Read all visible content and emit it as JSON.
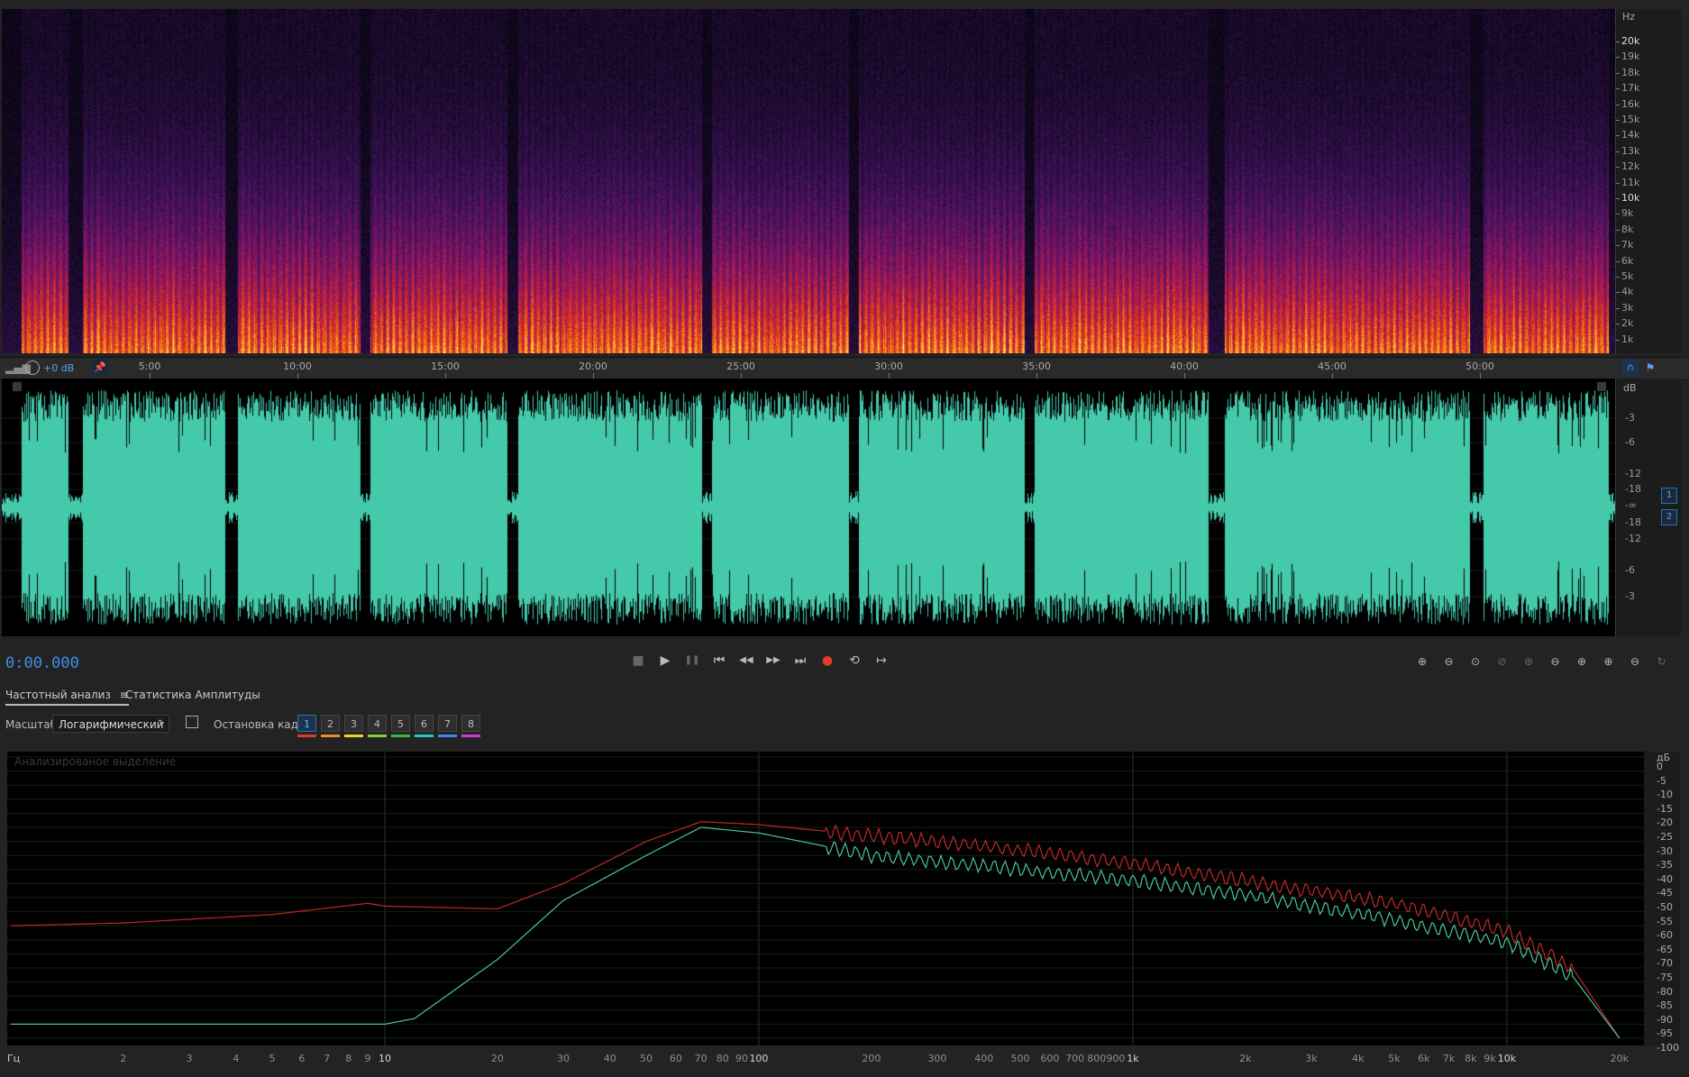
{
  "spectral": {
    "axis_unit": "Hz",
    "freq_ticks": [
      "20k",
      "19k",
      "18k",
      "17k",
      "16k",
      "15k",
      "14k",
      "13k",
      "12k",
      "11k",
      "10k",
      "9k",
      "8k",
      "7k",
      "6k",
      "5k",
      "4k",
      "3k",
      "2k",
      "1k"
    ]
  },
  "ruler": {
    "gain_label": "+0 dB",
    "time_ticks": [
      "5:00",
      "10:00",
      "15:00",
      "20:00",
      "25:00",
      "30:00",
      "35:00",
      "40:00",
      "45:00",
      "50:00"
    ]
  },
  "waveform": {
    "axis_unit": "dB",
    "db_ticks_top": [
      "-3",
      "-6",
      "-12",
      "-18",
      "-∞",
      "-18",
      "-12",
      "-6",
      "-3"
    ],
    "channels": [
      "1",
      "2"
    ],
    "color": "#45c9ab"
  },
  "transport": {
    "timecode": "0:00.000",
    "buttons": {
      "stop": "■",
      "play": "▶",
      "pause": "❚❚",
      "to_start": "⏮",
      "rewind": "◀◀",
      "forward": "▶▶",
      "to_end": "⏭",
      "record": "●",
      "loop": "⟲",
      "skip": "↦"
    }
  },
  "zoom_icons": [
    "zoom-in-amplitude",
    "zoom-out-amplitude",
    "zoom-selection",
    "zoom-out-full",
    "zoom-in-time",
    "zoom-out-time",
    "zoom-in-left",
    "zoom-in-right",
    "zoom-fit",
    "zoom-reset"
  ],
  "panel": {
    "tab_frequency": "Частотный анализ",
    "tab_menu_icon": "≡",
    "tab_amplitude": "Статистика Амплитуды",
    "scale_label": "Масштаб:",
    "scale_value": "Логарифмический",
    "freeze_label": "Остановка кадра:",
    "frames": [
      "1",
      "2",
      "3",
      "4",
      "5",
      "6",
      "7",
      "8"
    ],
    "frame_colors": [
      "#e23a2a",
      "#ee8a2a",
      "#e8d62a",
      "#7ed23a",
      "#3ab84a",
      "#2ac6d2",
      "#3a8ae8",
      "#d23ad2"
    ]
  },
  "frequency_analysis": {
    "selection_label": "Анализированое выделение",
    "db_unit": "дБ",
    "db_ticks": [
      "0",
      "-5",
      "-10",
      "-15",
      "-20",
      "-25",
      "-30",
      "-35",
      "-40",
      "-45",
      "-50",
      "-55",
      "-60",
      "-65",
      "-70",
      "-75",
      "-80",
      "-85",
      "-90",
      "-95",
      "-100"
    ],
    "hz_unit": "Гц",
    "hz_ticks": [
      "2",
      "3",
      "4",
      "5",
      "6",
      "7",
      "8",
      "9",
      "10",
      "20",
      "30",
      "40",
      "50",
      "60",
      "70",
      "80",
      "90",
      "100",
      "200",
      "300",
      "400",
      "500",
      "600",
      "700",
      "800",
      "900",
      "1k",
      "2k",
      "3k",
      "4k",
      "5k",
      "6k",
      "7k",
      "8k",
      "9k",
      "10k",
      "20k"
    ]
  },
  "chart_data": {
    "type": "line",
    "xlabel": "Гц",
    "ylabel": "дБ",
    "x_scale": "log",
    "ylim": [
      -100,
      0
    ],
    "series": [
      {
        "color": "#c0282a",
        "x": [
          1,
          2,
          5,
          9,
          10,
          20,
          30,
          50,
          70,
          100,
          200,
          500,
          1000,
          2000,
          5000,
          10000,
          15000,
          20000
        ],
        "y": [
          -60,
          -59,
          -56,
          -52,
          -53,
          -54,
          -45,
          -30,
          -23,
          -24,
          -28,
          -33,
          -38,
          -44,
          -52,
          -62,
          -75,
          -100
        ]
      },
      {
        "color": "#4cc49a",
        "x": [
          1,
          2,
          5,
          9,
          10,
          12,
          20,
          30,
          50,
          70,
          100,
          200,
          500,
          1000,
          2000,
          5000,
          10000,
          15000,
          20000
        ],
        "y": [
          -95,
          -95,
          -95,
          -95,
          -95,
          -93,
          -72,
          -51,
          -35,
          -25,
          -27,
          -35,
          -40,
          -44,
          -49,
          -58,
          -66,
          -78,
          -100
        ]
      }
    ]
  }
}
